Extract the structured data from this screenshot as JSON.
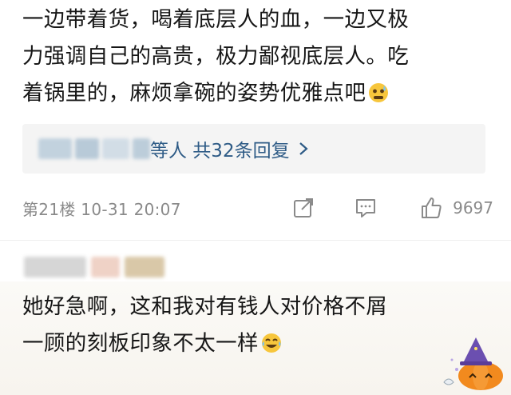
{
  "comment": {
    "lines": [
      "一边带着货，喝着底层人的血，一边又极",
      "力强调自己的高贵，极力鄙视底层人。吃",
      "着锅里的，麻烦拿碗的姿势优雅点吧"
    ],
    "emoji": "cold-sweat-emoji"
  },
  "reply_preview": {
    "names_blurred": "陳…",
    "summary": "等人  共32条回复",
    "chevron": "chevron-right-icon"
  },
  "meta": {
    "floor_time": "第21楼  10-31 20:07",
    "like_count": "9697",
    "icons": [
      "share-icon",
      "comment-icon",
      "like-icon"
    ]
  },
  "reply": {
    "user_blurred": "…",
    "lines": [
      "她好急啊，这和我对有钱人对价格不屑",
      "一顾的刻板印象不太一样"
    ],
    "emoji": "laugh-cry-emoji",
    "badge": "pumpkin-witch-badge"
  },
  "colors": {
    "text": "#161616",
    "link": "#2e5b86",
    "muted": "#8a8a8a",
    "reply_box": "#f4f4f4"
  }
}
